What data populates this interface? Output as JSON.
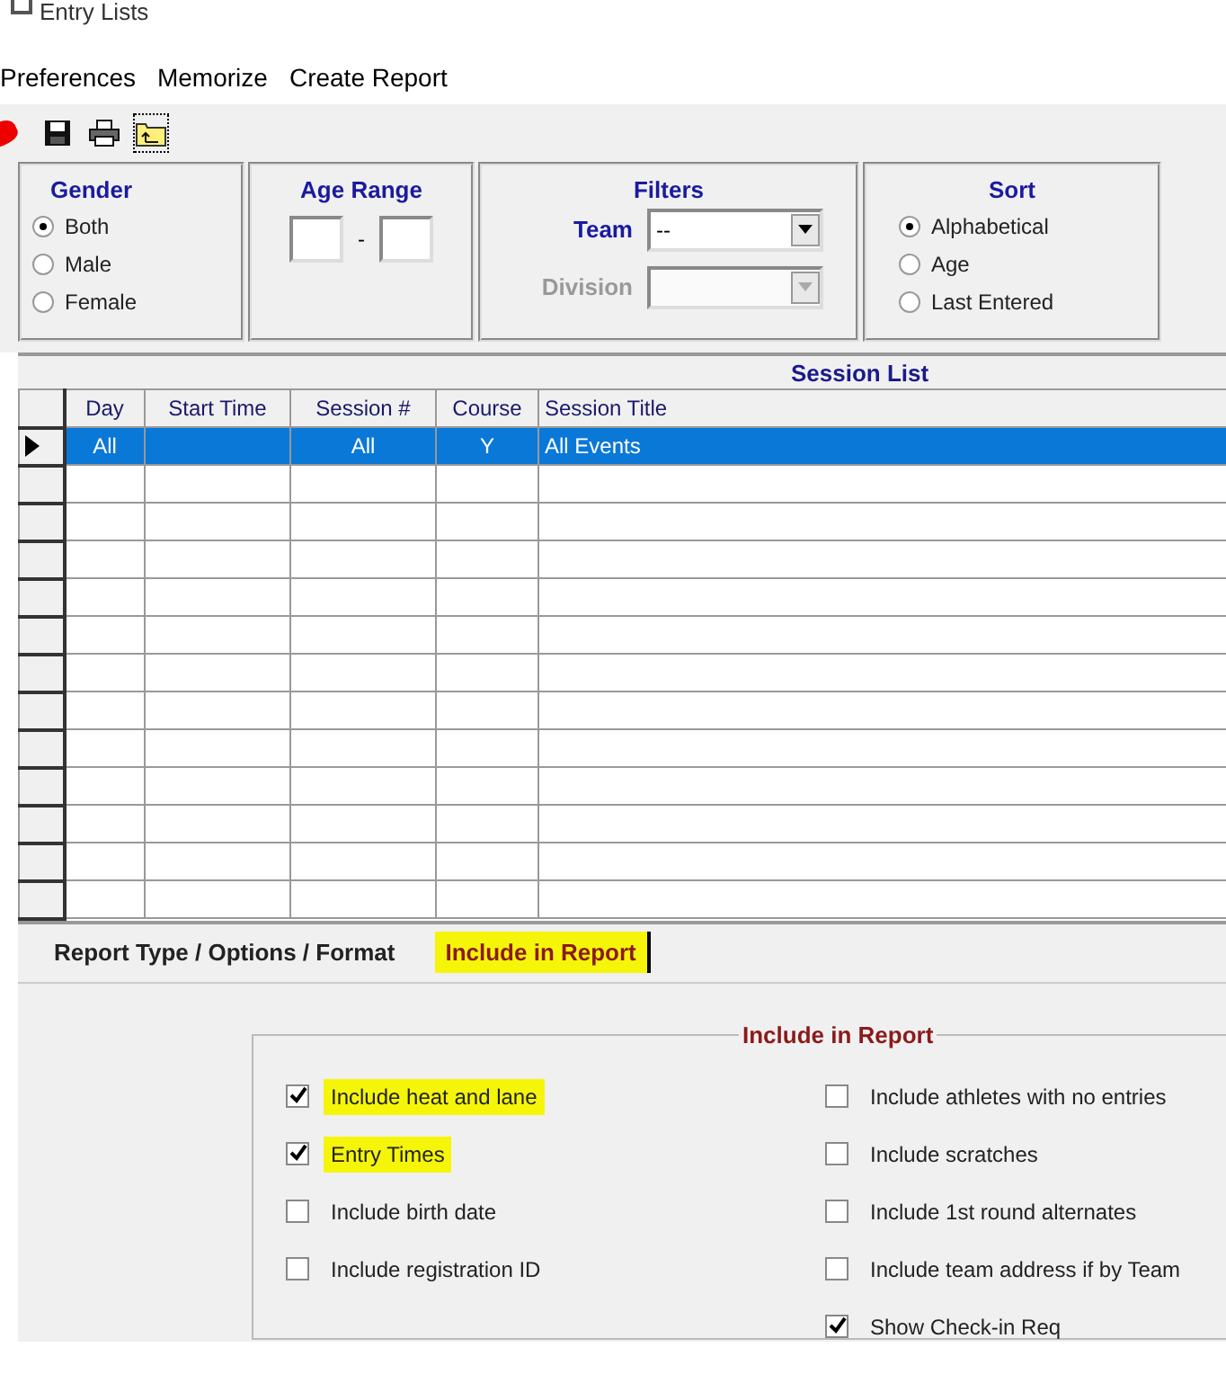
{
  "window": {
    "title": "Entry Lists"
  },
  "menu": [
    "Preferences",
    "Memorize",
    "Create Report"
  ],
  "toolbar": [
    {
      "kind": "heart"
    },
    {
      "kind": "save"
    },
    {
      "kind": "print"
    },
    {
      "kind": "folder-up"
    }
  ],
  "gender": {
    "title": "Gender",
    "options": [
      {
        "label": "Both",
        "selected": true
      },
      {
        "label": "Male",
        "selected": false
      },
      {
        "label": "Female",
        "selected": false
      }
    ]
  },
  "age_range": {
    "title": "Age Range",
    "separator": "-"
  },
  "filters": {
    "title": "Filters",
    "team": {
      "label": "Team",
      "value": "--",
      "disabled": false
    },
    "division": {
      "label": "Division",
      "disabled": true
    }
  },
  "sort": {
    "title": "Sort",
    "options": [
      {
        "label": "Alphabetical",
        "selected": true
      },
      {
        "label": "Age",
        "selected": false
      },
      {
        "label": "Last Entered",
        "selected": false
      }
    ]
  },
  "session_list": {
    "title": "Session List",
    "columns": [
      "Day",
      "Start Time",
      "Session #",
      "Course",
      "Session Title"
    ],
    "rows": [
      {
        "cells": [
          "All",
          "",
          "All",
          "Y",
          "All Events"
        ],
        "selected": true
      }
    ]
  },
  "tabs": [
    {
      "label": "Report Type / Options / Format",
      "selected": false,
      "highlighted": false
    },
    {
      "label": "Include in Report",
      "selected": true,
      "highlighted": true
    }
  ],
  "include_group": {
    "title": "Include in Report",
    "left": [
      {
        "label": "Include heat and lane",
        "checked": true,
        "highlighted": true
      },
      {
        "label": "Entry Times",
        "checked": true,
        "highlighted": true
      },
      {
        "label": "Include birth date",
        "checked": false,
        "highlighted": false
      },
      {
        "label": "Include registration ID",
        "checked": false,
        "highlighted": false
      }
    ],
    "right": [
      {
        "label": "Include athletes with no entries",
        "checked": false,
        "highlighted": false
      },
      {
        "label": "Include scratches",
        "checked": false,
        "highlighted": false
      },
      {
        "label": "Include 1st round alternates",
        "checked": false,
        "highlighted": false
      },
      {
        "label": "Include team address if by Team",
        "checked": false,
        "highlighted": false
      },
      {
        "label": "Show Check-in Req",
        "checked": true,
        "highlighted": false
      }
    ]
  }
}
